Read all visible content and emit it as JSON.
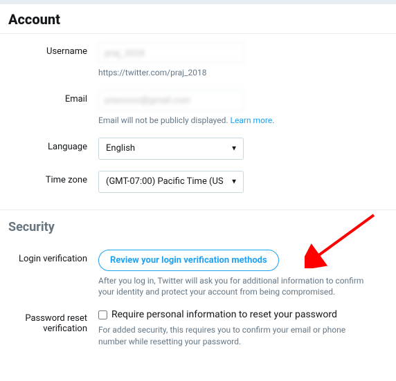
{
  "sections": {
    "account": {
      "title": "Account"
    },
    "security": {
      "title": "Security"
    }
  },
  "account": {
    "username": {
      "label": "Username",
      "value": "praj_2018",
      "help": "https://twitter.com/praj_2018"
    },
    "email": {
      "label": "Email",
      "value": "praxxxxx@gmail.com",
      "help_prefix": "Email will not be publicly displayed.",
      "learn_more": "Learn more"
    },
    "language": {
      "label": "Language",
      "value": "English"
    },
    "timezone": {
      "label": "Time zone",
      "value": "(GMT-07:00) Pacific Time (US"
    }
  },
  "security": {
    "login_verification": {
      "label": "Login verification",
      "button": "Review your login verification methods",
      "help": "After you log in, Twitter will ask you for additional information to confirm your identity and protect your account from being compromised."
    },
    "password_reset": {
      "label": "Password reset verification",
      "checkbox_label": "Require personal information to reset your password",
      "help": "For added security, this requires you to confirm your email or phone number while resetting your password."
    }
  }
}
